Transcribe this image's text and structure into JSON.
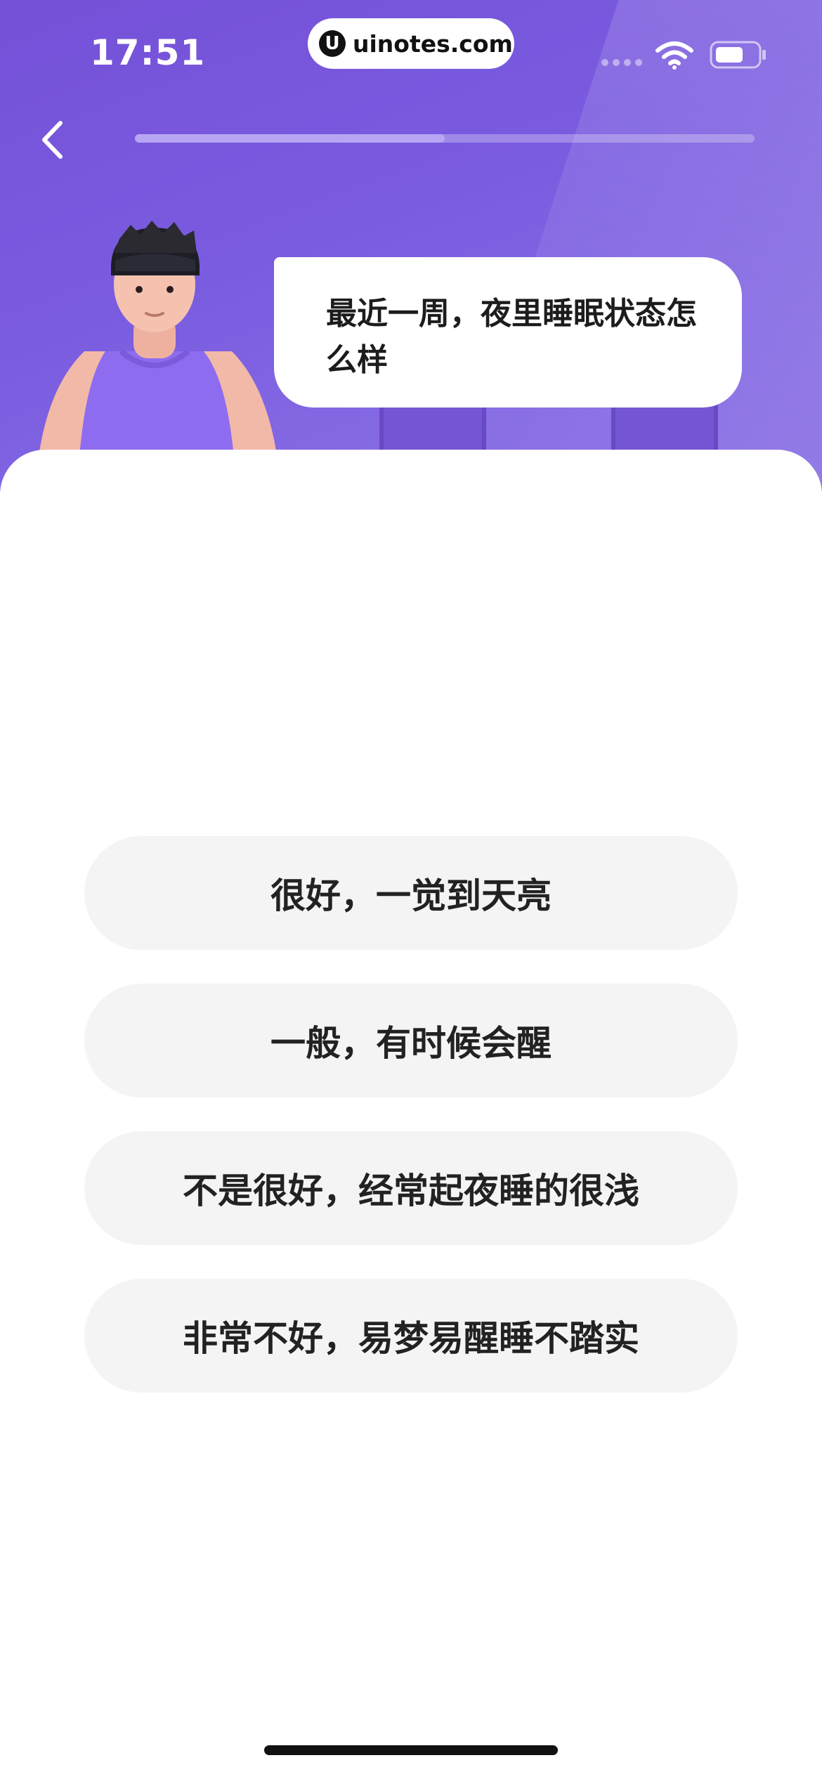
{
  "status_bar": {
    "time": "17:51",
    "site_label": "uinotes.com",
    "site_logo_letter": "U"
  },
  "header": {
    "progress": 0.5
  },
  "question": {
    "text": "最近一周，夜里睡眠状态怎么样"
  },
  "options": [
    {
      "label": "很好，一觉到天亮"
    },
    {
      "label": "一般，有时候会醒"
    },
    {
      "label": "不是很好，经常起夜睡的很浅"
    },
    {
      "label": "非常不好，易梦易醒睡不踏实"
    }
  ],
  "colors": {
    "hero_background": "#7a5ce0",
    "progress_fill": "#b6a6f4",
    "option_background": "#f4f4f4"
  },
  "icons": {
    "back": "chevron-left-icon",
    "wifi": "wifi-icon",
    "battery": "battery-icon",
    "avatar": "avatar-illustration"
  }
}
